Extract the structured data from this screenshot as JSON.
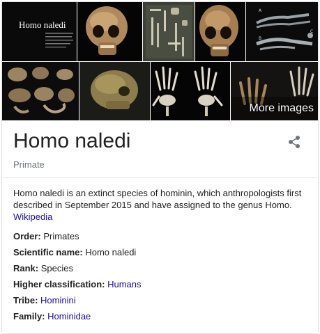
{
  "gallery": {
    "title_card": {
      "heading": "Homo naledi"
    },
    "more_images_label": "More images"
  },
  "entity": {
    "title": "Homo naledi",
    "subtitle": "Primate"
  },
  "description": {
    "text": "Homo naledi is an extinct species of hominin, which anthropologists first described in September 2015 and have assigned to the genus Homo.",
    "source_link": "Wikipedia"
  },
  "facts": [
    {
      "label": "Order:",
      "value": "Primates",
      "is_link": false
    },
    {
      "label": "Scientific name:",
      "value": "Homo naledi",
      "is_link": false
    },
    {
      "label": "Rank:",
      "value": "Species",
      "is_link": false
    },
    {
      "label": "Higher classification:",
      "value": "Humans",
      "is_link": true
    },
    {
      "label": "Tribe:",
      "value": "Hominini",
      "is_link": true
    },
    {
      "label": "Family:",
      "value": "Hominidae",
      "is_link": true
    }
  ],
  "colors": {
    "link": "#1a0dab",
    "text": "#222222",
    "muted": "#70757a"
  }
}
